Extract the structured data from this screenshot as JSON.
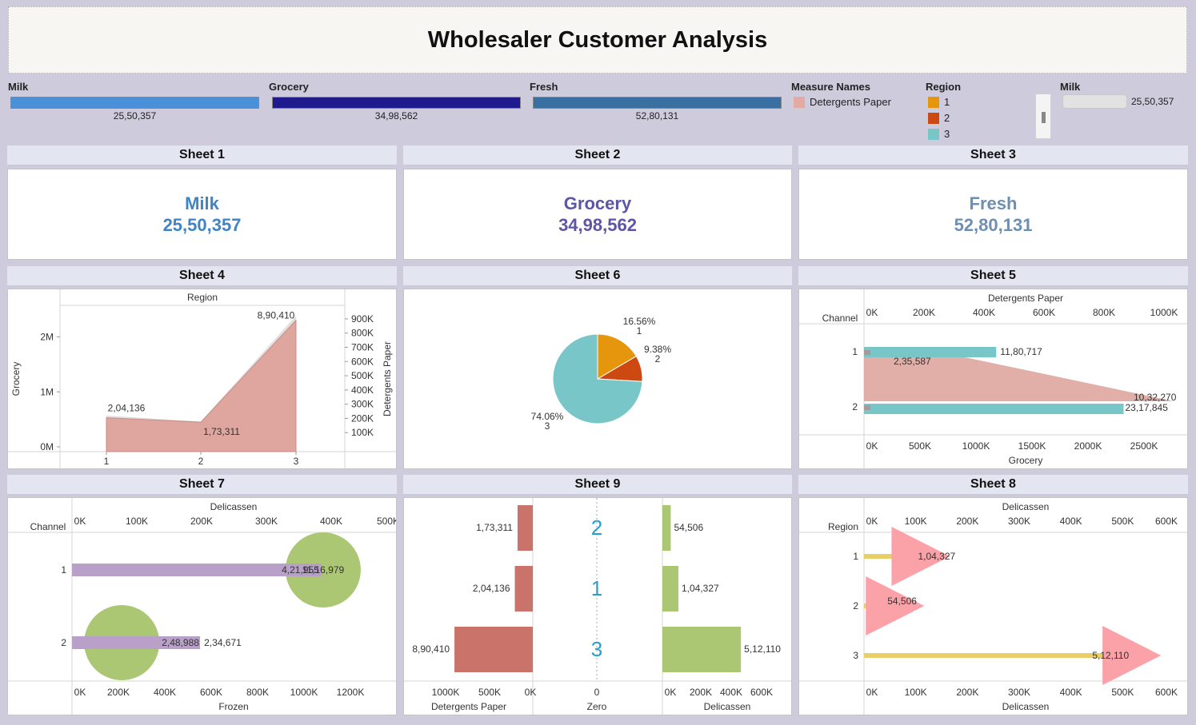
{
  "title": "Wholesaler Customer Analysis",
  "filters": [
    {
      "label": "Milk",
      "value": "25,50,357",
      "color": "#4a90d9"
    },
    {
      "label": "Grocery",
      "value": "34,98,562",
      "color": "#1f1a8e"
    },
    {
      "label": "Fresh",
      "value": "52,80,131",
      "color": "#3a6fa2"
    }
  ],
  "measure_legend": {
    "title": "Measure Names",
    "items": [
      {
        "label": "Detergents Paper",
        "color": "#e2aaa2"
      }
    ]
  },
  "region_legend": {
    "title": "Region",
    "items": [
      {
        "label": "1",
        "color": "#e5960c"
      },
      {
        "label": "2",
        "color": "#cc4a12"
      },
      {
        "label": "3",
        "color": "#79c6c8"
      }
    ]
  },
  "milk_slider": {
    "label": "Milk",
    "value": "25,50,357"
  },
  "sheets": {
    "s1": {
      "title": "Sheet 1",
      "label": "Milk",
      "value": "25,50,357",
      "color": "#4084c5"
    },
    "s2": {
      "title": "Sheet 2",
      "label": "Grocery",
      "value": "34,98,562",
      "color": "#5d55a5"
    },
    "s3": {
      "title": "Sheet 3",
      "label": "Fresh",
      "value": "52,80,131",
      "color": "#6c8fb3"
    },
    "s4": {
      "title": "Sheet 4"
    },
    "s6": {
      "title": "Sheet 6"
    },
    "s5": {
      "title": "Sheet 5"
    },
    "s7": {
      "title": "Sheet 7"
    },
    "s9": {
      "title": "Sheet 9"
    },
    "s8": {
      "title": "Sheet 8"
    }
  },
  "chart_data": [
    {
      "id": "sheet4",
      "type": "area",
      "title": "Region",
      "ylabel": "Grocery",
      "y2label": "Detergents Paper",
      "x": [
        "1",
        "2",
        "3"
      ],
      "series": [
        {
          "name": "Grocery",
          "values": [
            570000,
            460000,
            2390000
          ],
          "color": "#e0e0e0"
        },
        {
          "name": "Detergents Paper",
          "values": [
            204136,
            173311,
            890410
          ],
          "color": "#dea69e",
          "labels": [
            "2,04,136",
            "1,73,311",
            "8,90,410"
          ]
        }
      ],
      "yticks": [
        "0M",
        "1M",
        "2M"
      ],
      "y2ticks": [
        "100K",
        "200K",
        "300K",
        "400K",
        "500K",
        "600K",
        "700K",
        "800K",
        "900K"
      ]
    },
    {
      "id": "sheet6",
      "type": "pie",
      "slices": [
        {
          "label": "1",
          "percent": "16.56%",
          "value": 16.56,
          "color": "#e5960c"
        },
        {
          "label": "2",
          "percent": "9.38%",
          "value": 9.38,
          "color": "#cc4a12"
        },
        {
          "label": "3",
          "percent": "74.06%",
          "value": 74.06,
          "color": "#79c6c8"
        }
      ]
    },
    {
      "id": "sheet5",
      "type": "bar",
      "xlabel_top": "Detergents Paper",
      "xlabel_bottom": "Grocery",
      "ylabel": "Channel",
      "categories": [
        "1",
        "2"
      ],
      "top_ticks": [
        "0K",
        "200K",
        "400K",
        "600K",
        "800K",
        "1000K"
      ],
      "bottom_ticks": [
        "0K",
        "500K",
        "1000K",
        "1500K",
        "2000K",
        "2500K"
      ],
      "grocery": [
        1180717,
        2317845
      ],
      "grocery_labels": [
        "11,80,717",
        "23,17,845"
      ],
      "detergents": [
        235587,
        1032270
      ],
      "detergents_labels": [
        "2,35,587",
        "10,32,270"
      ]
    },
    {
      "id": "sheet7",
      "type": "bar",
      "xlabel_top": "Delicassen",
      "xlabel_bottom": "Frozen",
      "ylabel": "Channel",
      "categories": [
        "1",
        "2"
      ],
      "top_ticks": [
        "0K",
        "100K",
        "200K",
        "300K",
        "400K",
        "500K"
      ],
      "bottom_ticks": [
        "0K",
        "200K",
        "400K",
        "600K",
        "800K",
        "1000K",
        "1200K"
      ],
      "delicassen": [
        421955,
        234671
      ],
      "delicassen_labels": [
        "4,21,955",
        "2,34,671"
      ],
      "frozen": [
        1116979,
        248988
      ],
      "frozen_labels": [
        "11,16,979",
        "2,48,988"
      ]
    },
    {
      "id": "sheet9",
      "type": "bar",
      "rows": [
        "2",
        "1",
        "3"
      ],
      "detergents": [
        173311,
        204136,
        890410
      ],
      "detergents_labels": [
        "1,73,311",
        "2,04,136",
        "8,90,410"
      ],
      "delicassen": [
        54506,
        104327,
        512110
      ],
      "delicassen_labels": [
        "54,506",
        "1,04,327",
        "5,12,110"
      ],
      "left_ticks": [
        "1000K",
        "500K",
        "0K"
      ],
      "mid_tick": "0",
      "right_ticks": [
        "0K",
        "200K",
        "400K",
        "600K"
      ],
      "left_label": "Detergents Paper",
      "mid_label": "Zero",
      "right_label": "Delicassen"
    },
    {
      "id": "sheet8",
      "type": "bar",
      "xlabel_top": "Delicassen",
      "xlabel_bottom": "Delicassen",
      "ylabel": "Region",
      "categories": [
        "1",
        "2",
        "3"
      ],
      "ticks": [
        "0K",
        "100K",
        "200K",
        "300K",
        "400K",
        "500K",
        "600K"
      ],
      "values": [
        104327,
        54506,
        512110
      ],
      "labels": [
        "1,04,327",
        "54,506",
        "5,12,110"
      ]
    }
  ]
}
